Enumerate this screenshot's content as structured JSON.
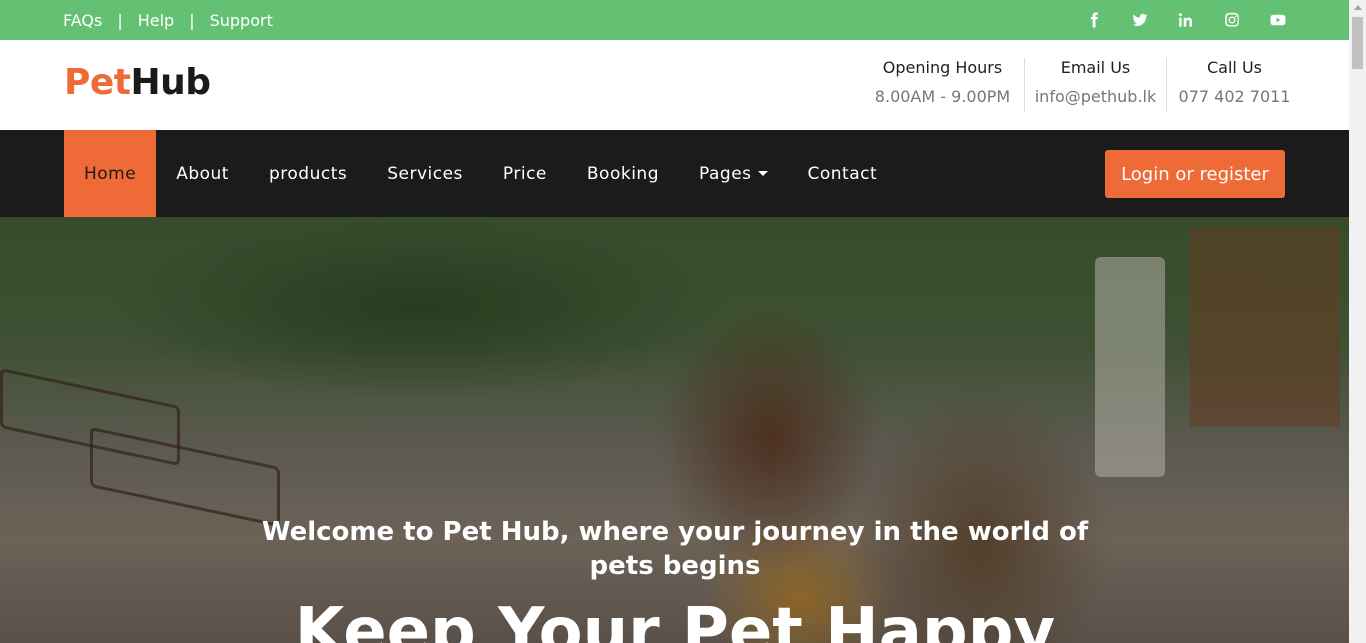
{
  "topbar": {
    "links": [
      "FAQs",
      "Help",
      "Support"
    ],
    "separator": "|",
    "social": [
      "facebook-icon",
      "twitter-icon",
      "linkedin-icon",
      "instagram-icon",
      "youtube-icon"
    ],
    "bg_color": "#64c174"
  },
  "brand": {
    "part1": "Pet",
    "part2": "Hub",
    "accent": "#ee6a36"
  },
  "contact": [
    {
      "title": "Opening Hours",
      "value": "8.00AM - 9.00PM"
    },
    {
      "title": "Email Us",
      "value": "info@pethub.lk"
    },
    {
      "title": "Call Us",
      "value": "077 402 7011"
    }
  ],
  "nav": {
    "items": [
      "Home",
      "About",
      "products",
      "Services",
      "Price",
      "Booking",
      "Pages",
      "Contact"
    ],
    "active": "Home",
    "login_label": "Login or register"
  },
  "hero": {
    "welcome": "Welcome to Pet Hub, where your journey in the world of pets begins",
    "headline": "Keep Your Pet Happy"
  }
}
